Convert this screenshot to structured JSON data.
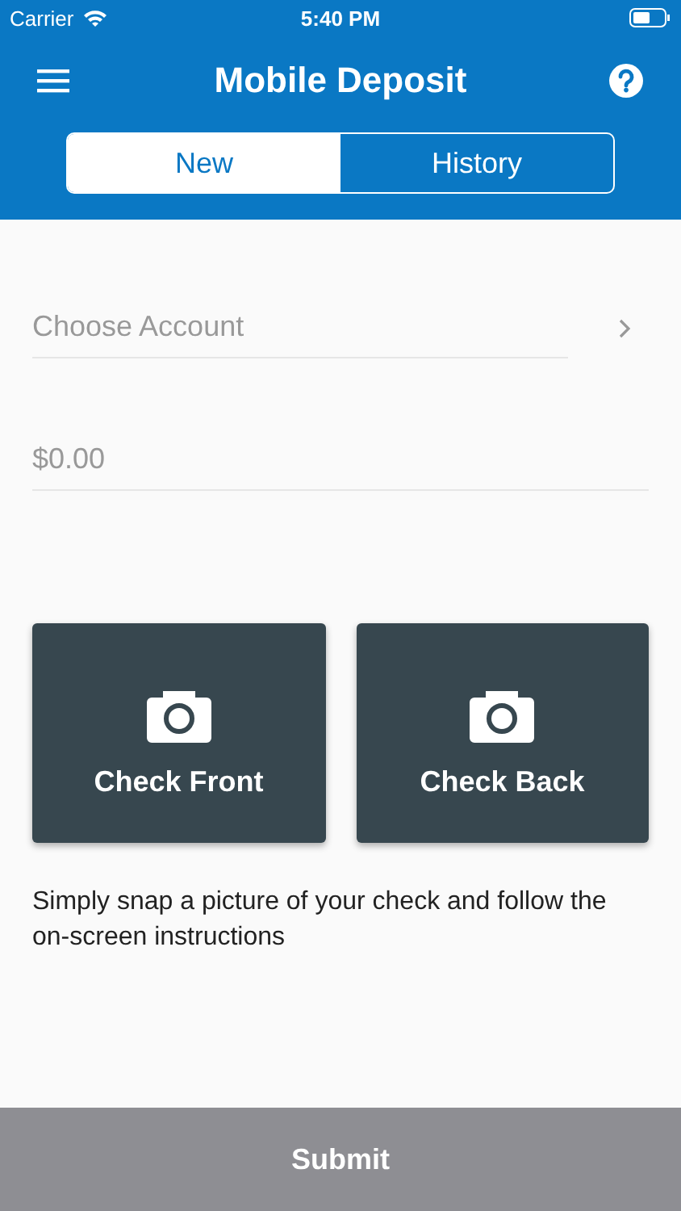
{
  "status_bar": {
    "carrier": "Carrier",
    "time": "5:40 PM"
  },
  "header": {
    "title": "Mobile Deposit"
  },
  "tabs": [
    {
      "label": "New",
      "selected": true
    },
    {
      "label": "History",
      "selected": false
    }
  ],
  "account": {
    "placeholder": "Choose Account"
  },
  "amount": {
    "placeholder": "$0.00"
  },
  "capture_tiles": [
    {
      "label": "Check Front"
    },
    {
      "label": "Check Back"
    }
  ],
  "instructions": "Simply snap a picture of your check and follow the on-screen instructions",
  "submit": {
    "label": "Submit"
  }
}
